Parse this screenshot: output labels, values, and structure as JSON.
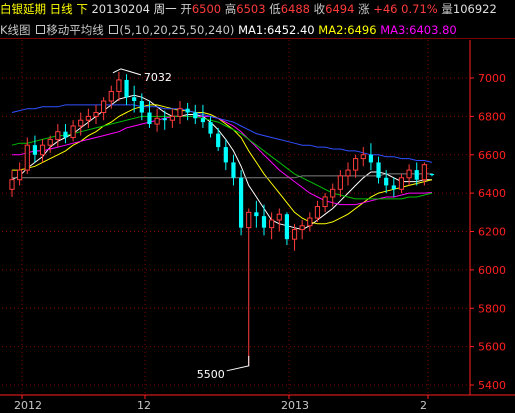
{
  "header": {
    "name": "白银延期",
    "period": "日线",
    "down": "下",
    "date": "20130204",
    "weekday": "周一",
    "open_label": "开",
    "open_value": "6500",
    "high_label": "高",
    "high_value": "6503",
    "low_label": "低",
    "low_value": "6488",
    "close_label": "收",
    "close_value": "6494",
    "change_label": "涨",
    "change_value": "+46",
    "change_pct": "0.71%",
    "volume_label": "量",
    "volume_value": "106922"
  },
  "indicator": {
    "kline_label": "K线图",
    "ma_label": "移动平均线",
    "ma_params": "(5,10,20,25,50,240)",
    "ma1": "MA1:6452.40",
    "ma2": "MA2:6496",
    "ma3": "MA3:6403.80"
  },
  "chart_data": {
    "type": "candlestick",
    "y_ticks": [
      "7000",
      "6800",
      "6600",
      "6400",
      "6200",
      "6000",
      "5800",
      "5600",
      "5400"
    ],
    "ylim": [
      5400,
      7000
    ],
    "x_ticks": [
      "2012",
      "12",
      "2013",
      "2"
    ],
    "annotations": {
      "high_label": "7032",
      "low_label": "5500"
    },
    "candles": [
      [
        6420,
        6520,
        6380,
        6470
      ],
      [
        6470,
        6560,
        6440,
        6520
      ],
      [
        6520,
        6690,
        6500,
        6650
      ],
      [
        6650,
        6700,
        6560,
        6600
      ],
      [
        6600,
        6680,
        6560,
        6650
      ],
      [
        6650,
        6700,
        6610,
        6680
      ],
      [
        6680,
        6760,
        6640,
        6720
      ],
      [
        6720,
        6760,
        6660,
        6690
      ],
      [
        6690,
        6780,
        6670,
        6750
      ],
      [
        6750,
        6820,
        6700,
        6780
      ],
      [
        6780,
        6840,
        6740,
        6800
      ],
      [
        6800,
        6860,
        6760,
        6820
      ],
      [
        6820,
        6900,
        6780,
        6880
      ],
      [
        6880,
        6960,
        6840,
        6930
      ],
      [
        6930,
        7032,
        6880,
        6990
      ],
      [
        6990,
        7020,
        6860,
        6900
      ],
      [
        6900,
        6960,
        6820,
        6880
      ],
      [
        6880,
        6920,
        6780,
        6820
      ],
      [
        6820,
        6880,
        6740,
        6760
      ],
      [
        6760,
        6840,
        6720,
        6790
      ],
      [
        6790,
        6830,
        6730,
        6780
      ],
      [
        6780,
        6840,
        6740,
        6800
      ],
      [
        6800,
        6880,
        6760,
        6840
      ],
      [
        6840,
        6870,
        6780,
        6820
      ],
      [
        6820,
        6860,
        6760,
        6790
      ],
      [
        6790,
        6860,
        6740,
        6770
      ],
      [
        6770,
        6800,
        6690,
        6710
      ],
      [
        6710,
        6740,
        6620,
        6640
      ],
      [
        6640,
        6680,
        6520,
        6560
      ],
      [
        6560,
        6600,
        6440,
        6480
      ],
      [
        6480,
        6520,
        6180,
        6220
      ],
      [
        6220,
        6320,
        5500,
        6300
      ],
      [
        6300,
        6360,
        6220,
        6280
      ],
      [
        6280,
        6340,
        6180,
        6220
      ],
      [
        6220,
        6300,
        6160,
        6260
      ],
      [
        6260,
        6320,
        6200,
        6290
      ],
      [
        6290,
        6300,
        6130,
        6160
      ],
      [
        6160,
        6240,
        6100,
        6210
      ],
      [
        6210,
        6260,
        6160,
        6230
      ],
      [
        6230,
        6300,
        6200,
        6270
      ],
      [
        6270,
        6360,
        6250,
        6330
      ],
      [
        6330,
        6400,
        6300,
        6380
      ],
      [
        6380,
        6450,
        6330,
        6420
      ],
      [
        6420,
        6520,
        6380,
        6490
      ],
      [
        6490,
        6560,
        6440,
        6520
      ],
      [
        6520,
        6600,
        6480,
        6580
      ],
      [
        6580,
        6640,
        6540,
        6600
      ],
      [
        6600,
        6660,
        6520,
        6560
      ],
      [
        6560,
        6590,
        6450,
        6480
      ],
      [
        6480,
        6520,
        6400,
        6440
      ],
      [
        6440,
        6480,
        6380,
        6420
      ],
      [
        6420,
        6500,
        6400,
        6480
      ],
      [
        6480,
        6550,
        6440,
        6520
      ],
      [
        6520,
        6560,
        6440,
        6470
      ],
      [
        6470,
        6560,
        6440,
        6548
      ],
      [
        6500,
        6503,
        6488,
        6494
      ]
    ],
    "series": [
      {
        "name": "MA1",
        "color": "#ffffff",
        "values": [
          6470,
          6490,
          6530,
          6560,
          6590,
          6640,
          6670,
          6690,
          6710,
          6740,
          6770,
          6800,
          6830,
          6860,
          6890,
          6900,
          6910,
          6900,
          6880,
          6850,
          6820,
          6800,
          6800,
          6810,
          6810,
          6800,
          6770,
          6730,
          6680,
          6620,
          6540,
          6440,
          6380,
          6320,
          6260,
          6240,
          6230,
          6220,
          6210,
          6230,
          6260,
          6290,
          6320,
          6360,
          6400,
          6440,
          6480,
          6510,
          6510,
          6500,
          6480,
          6460,
          6460,
          6460,
          6470,
          6470
        ]
      },
      {
        "name": "MA2",
        "color": "#ffff00",
        "values": [
          6520,
          6520,
          6530,
          6540,
          6560,
          6580,
          6600,
          6620,
          6650,
          6670,
          6700,
          6720,
          6750,
          6770,
          6800,
          6820,
          6840,
          6850,
          6860,
          6860,
          6850,
          6840,
          6830,
          6830,
          6820,
          6820,
          6810,
          6790,
          6760,
          6730,
          6690,
          6620,
          6560,
          6500,
          6450,
          6400,
          6350,
          6300,
          6270,
          6250,
          6240,
          6240,
          6250,
          6270,
          6290,
          6320,
          6350,
          6380,
          6400,
          6410,
          6420,
          6430,
          6440,
          6450,
          6460,
          6470
        ]
      },
      {
        "name": "MA3",
        "color": "#ff00ff",
        "values": [
          6600,
          6600,
          6610,
          6620,
          6620,
          6630,
          6640,
          6650,
          6660,
          6670,
          6680,
          6690,
          6700,
          6710,
          6720,
          6740,
          6750,
          6760,
          6770,
          6780,
          6790,
          6800,
          6800,
          6800,
          6800,
          6800,
          6800,
          6790,
          6770,
          6750,
          6720,
          6680,
          6640,
          6600,
          6560,
          6520,
          6490,
          6460,
          6430,
          6400,
          6380,
          6360,
          6350,
          6340,
          6340,
          6340,
          6350,
          6360,
          6370,
          6380,
          6380,
          6390,
          6400,
          6400,
          6400,
          6403
        ]
      },
      {
        "name": "MA4",
        "color": "#00c000",
        "values": [
          6650,
          6660,
          6660,
          6670,
          6680,
          6690,
          6700,
          6700,
          6710,
          6720,
          6730,
          6740,
          6750,
          6760,
          6770,
          6780,
          6790,
          6800,
          6800,
          6800,
          6800,
          6800,
          6800,
          6800,
          6800,
          6790,
          6780,
          6770,
          6750,
          6730,
          6710,
          6680,
          6650,
          6620,
          6590,
          6560,
          6530,
          6500,
          6480,
          6460,
          6440,
          6420,
          6400,
          6390,
          6380,
          6370,
          6370,
          6370,
          6370,
          6370,
          6370,
          6370,
          6380,
          6380,
          6390,
          6400
        ]
      },
      {
        "name": "MA5",
        "color": "#3050ff",
        "values": [
          6820,
          6830,
          6840,
          6840,
          6850,
          6850,
          6850,
          6860,
          6860,
          6860,
          6860,
          6860,
          6860,
          6860,
          6860,
          6860,
          6860,
          6850,
          6850,
          6850,
          6840,
          6840,
          6840,
          6830,
          6820,
          6810,
          6800,
          6790,
          6780,
          6770,
          6750,
          6730,
          6710,
          6700,
          6690,
          6680,
          6670,
          6660,
          6650,
          6650,
          6640,
          6640,
          6630,
          6630,
          6620,
          6620,
          6610,
          6600,
          6600,
          6590,
          6590,
          6580,
          6580,
          6570,
          6570,
          6560
        ]
      },
      {
        "name": "MA6",
        "color": "#808080",
        "values": [
          6480,
          6480,
          6480,
          6480,
          6480,
          6480,
          6480,
          6480,
          6480,
          6480,
          6480,
          6480,
          6480,
          6480,
          6480,
          6480,
          6480,
          6480,
          6480,
          6480,
          6480,
          6480,
          6480,
          6480,
          6480,
          6480,
          6480,
          6480,
          6480,
          6480,
          6480,
          6480,
          6480,
          6480,
          6480,
          6480,
          6480,
          6480,
          6490,
          6490,
          6490,
          6490,
          6490,
          6490,
          6490,
          6490,
          6490,
          6490,
          6490,
          6500,
          6500,
          6500,
          6500,
          6500,
          6500,
          6500
        ]
      }
    ]
  },
  "colors": {
    "up": "#ff3c3c",
    "down": "#00ffff",
    "grid": "#800000",
    "axis": "#ff2020",
    "text": "#c8c8c8",
    "ma1": "#ffffff",
    "ma2": "#ffff00",
    "ma3": "#ff00ff"
  }
}
